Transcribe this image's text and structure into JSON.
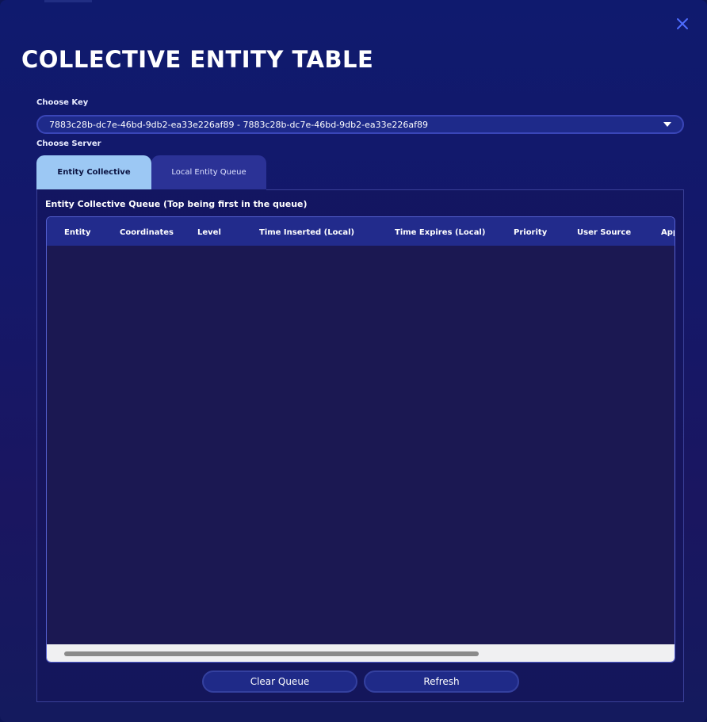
{
  "modal": {
    "title": "COLLECTIVE ENTITY TABLE"
  },
  "key": {
    "label": "Choose Key",
    "selected": "7883c28b-dc7e-46bd-9db2-ea33e226af89 - 7883c28b-dc7e-46bd-9db2-ea33e226af89"
  },
  "server": {
    "label": "Choose Server",
    "tabs": [
      {
        "label": "Entity Collective",
        "active": true
      },
      {
        "label": "Local Entity Queue",
        "active": false
      }
    ]
  },
  "queue": {
    "title": "Entity Collective Queue (Top being first in the queue)",
    "columns": [
      "Entity",
      "Coordinates",
      "Level",
      "Time Inserted (Local)",
      "Time Expires (Local)",
      "Priority",
      "User Source",
      "App"
    ],
    "rows": []
  },
  "buttons": {
    "clear": "Clear Queue",
    "refresh": "Refresh"
  },
  "colors": {
    "accent": "#9cc8f4",
    "close": "#4e6cff"
  }
}
